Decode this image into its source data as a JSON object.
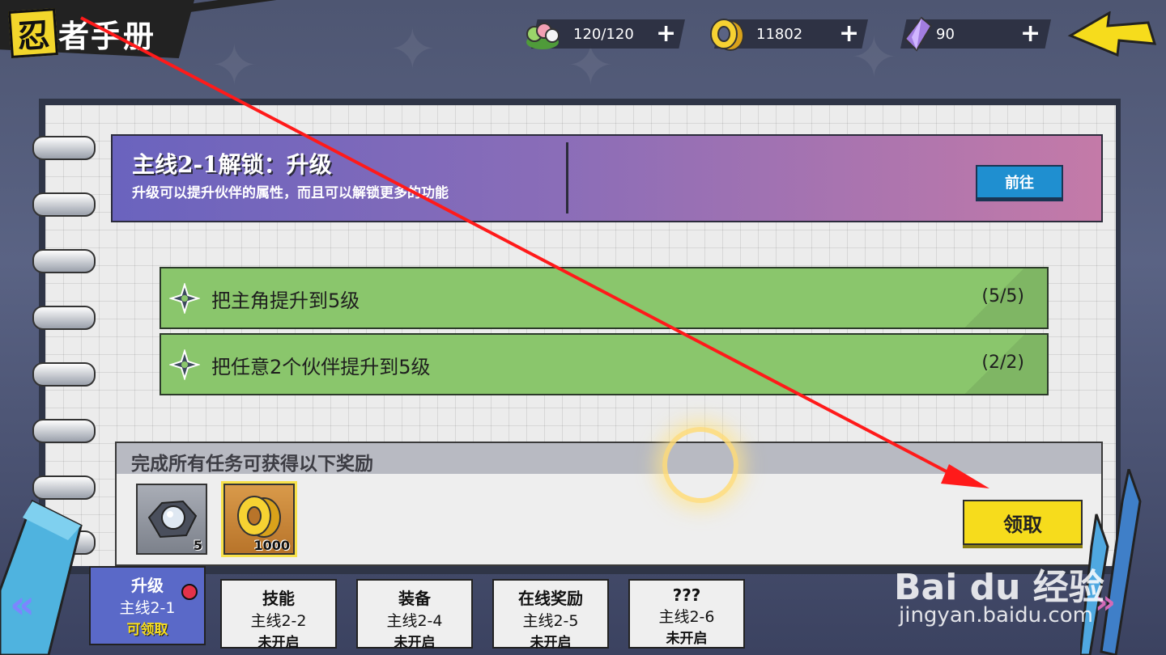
{
  "header": {
    "title_badge": "忍",
    "title_rest": "者手册",
    "resources": [
      {
        "icon": "dango-icon",
        "value": "120/120",
        "plus": "+"
      },
      {
        "icon": "gold-coin-icon",
        "value": "11802",
        "plus": "+"
      },
      {
        "icon": "crystal-icon",
        "value": "90",
        "plus": "+"
      }
    ],
    "back_icon": "back-arrow-icon"
  },
  "banner": {
    "title": "主线2-1解锁：升级",
    "description": "升级可以提升伙伴的属性，而且可以解锁更多的功能",
    "goto_label": "前往"
  },
  "tasks": [
    {
      "label": "把主角提升到5级",
      "progress": "(5/5)"
    },
    {
      "label": "把任意2个伙伴提升到5级",
      "progress": "(2/2)"
    }
  ],
  "reward": {
    "title": "完成所有任务可获得以下奖励",
    "items": [
      {
        "name": "orb-item",
        "qty": "5"
      },
      {
        "name": "gold-coin-item",
        "qty": "1000"
      }
    ],
    "claim_label": "领取"
  },
  "tabs": [
    {
      "title": "升级",
      "chapter": "主线2-1",
      "status": "可领取",
      "active": true
    },
    {
      "title": "技能",
      "chapter": "主线2-2",
      "status": "未开启",
      "active": false
    },
    {
      "title": "装备",
      "chapter": "主线2-4",
      "status": "未开启",
      "active": false
    },
    {
      "title": "在线奖励",
      "chapter": "主线2-5",
      "status": "未开启",
      "active": false
    },
    {
      "title": "???",
      "chapter": "主线2-6",
      "status": "未开启",
      "active": false
    }
  ],
  "nav": {
    "left": "«",
    "right": "»"
  },
  "watermark": {
    "brand": "Bai du 经验",
    "url": "jingyan.baidu.com"
  },
  "colors": {
    "accent_yellow": "#f6dc1c",
    "task_green": "#8ac66c",
    "active_tab": "#5a69c8",
    "annotation_red": "#ff1a1a"
  }
}
